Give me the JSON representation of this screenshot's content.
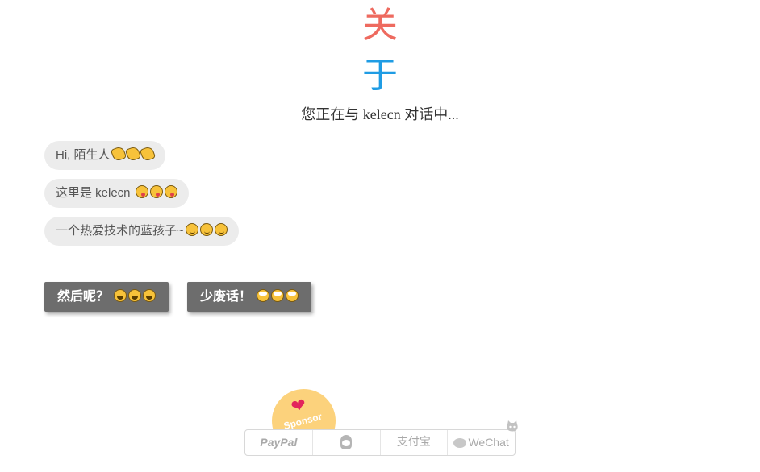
{
  "title": {
    "char1": "关",
    "char2": "于",
    "subtitle": "您正在与 kelecn 对话中..."
  },
  "messages": [
    {
      "text": "Hi, 陌生人",
      "emoji": "waving-hand-icon",
      "emoji_count": 3
    },
    {
      "text": "这里是 kelecn ",
      "emoji": "yum-face-icon",
      "emoji_count": 3
    },
    {
      "text": "一个热爱技术的蓝孩子~",
      "emoji": "wink-face-icon",
      "emoji_count": 3
    }
  ],
  "buttons": [
    {
      "label": "然后呢？",
      "emoji": "grin-face-icon",
      "emoji_count": 3
    },
    {
      "label": "少废话！",
      "emoji": "eye-roll-face-icon",
      "emoji_count": 3
    }
  ],
  "sponsor": {
    "label": "Sponsor",
    "icon": "heart-icon",
    "color": "#fcd27c"
  },
  "payment": {
    "paypal": "PayPal",
    "qq": "qq-penguin-icon",
    "alipay": "支付宝",
    "wechat": "WeChat"
  },
  "colors": {
    "title_char1": "#ee6a5f",
    "title_char2": "#1f9ce4",
    "bubble_bg": "#ececec",
    "button_bg": "#6d6d6d"
  }
}
